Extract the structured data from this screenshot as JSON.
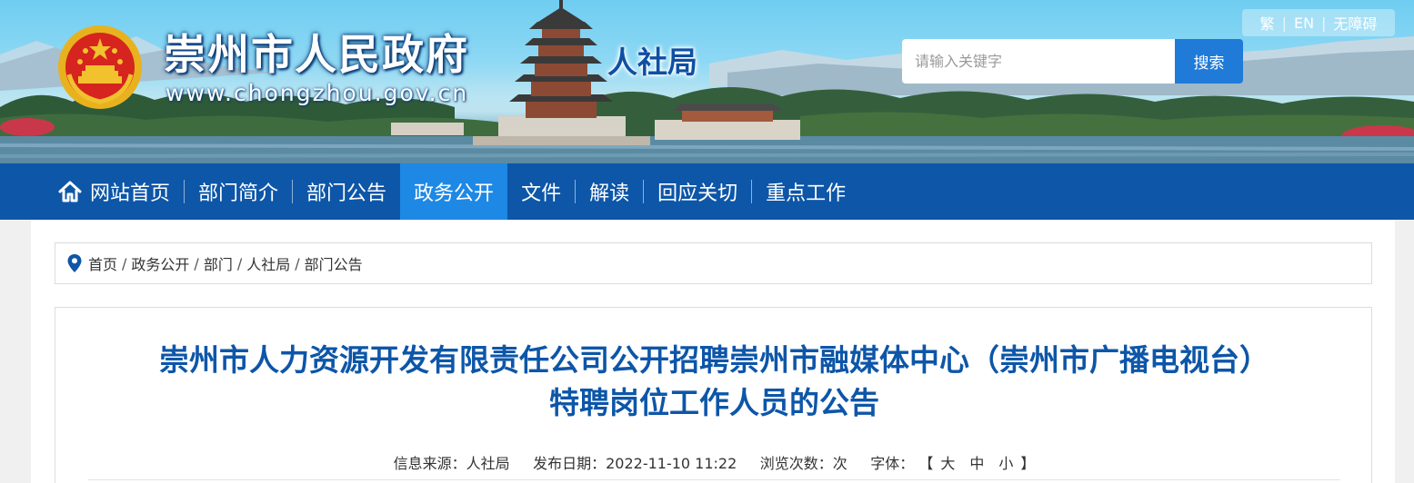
{
  "header": {
    "site_title": "崇州市人民政府",
    "site_url": "www.chongzhou.gov.cn",
    "department": "人社局",
    "top_links": [
      "繁",
      "EN",
      "无障碍"
    ],
    "search": {
      "placeholder": "请输入关键字",
      "value": "",
      "button_label": "搜索"
    }
  },
  "nav": {
    "items": [
      {
        "label": "网站首页",
        "icon": "home-icon",
        "active": false
      },
      {
        "label": "部门简介",
        "active": false
      },
      {
        "label": "部门公告",
        "active": false
      },
      {
        "label": "政务公开",
        "active": true
      },
      {
        "label": "文件",
        "active": false
      },
      {
        "label": "解读",
        "active": false
      },
      {
        "label": "回应关切",
        "active": false
      },
      {
        "label": "重点工作",
        "active": false
      }
    ],
    "bar_color": "#0d56a8",
    "active_color": "#1e88e5"
  },
  "breadcrumb": {
    "icon": "location-pin-icon",
    "items": [
      "首页",
      "政务公开",
      "部门",
      "人社局",
      "部门公告"
    ],
    "separator": "/"
  },
  "article": {
    "title_line1": "崇州市人力资源开发有限责任公司公开招聘崇州市融媒体中心（崇州市广播电视台）",
    "title_line2": "特聘岗位工作人员的公告",
    "meta": {
      "source_label": "信息来源：",
      "source": "人社局",
      "date_label": "发布日期：",
      "date": "2022-11-10 11:22",
      "views_label": "浏览次数：",
      "views_unit": "次",
      "font_label": "字体：",
      "bracket_open": "【",
      "font_sizes": [
        "大",
        "中",
        "小"
      ],
      "bracket_close": "】"
    },
    "title_color": "#0d56a8"
  }
}
